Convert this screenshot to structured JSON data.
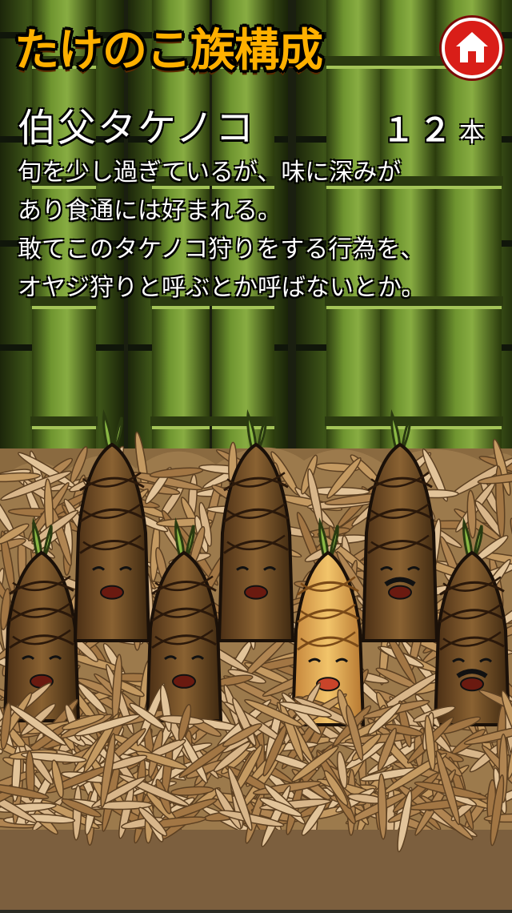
{
  "header": {
    "title": "たけのこ族構成",
    "home_button_icon": "home-icon"
  },
  "character": {
    "name": "伯父タケノコ",
    "count": "１２",
    "count_unit": "本",
    "description_lines": [
      "旬を少し過ぎているが、味に深みが",
      "あり食通には好まれる。",
      "敢てこのタケノコ狩りをする行為を、",
      "オヤジ狩りと呼ぶとか呼ばないとか。"
    ]
  },
  "family": [
    {
      "role": "baby",
      "highlighted": false
    },
    {
      "role": "winking-laughing",
      "highlighted": false
    },
    {
      "role": "angry-child",
      "highlighted": false
    },
    {
      "role": "smiling-mother",
      "highlighted": false
    },
    {
      "role": "uncle",
      "highlighted": true
    },
    {
      "role": "mustache-father",
      "highlighted": false
    },
    {
      "role": "old-grandpa",
      "highlighted": false
    }
  ],
  "colors": {
    "title": "#ffb000",
    "home_button": "#d91e18",
    "bamboo": "#6b8a2a",
    "soil": "#7a5a35",
    "shoot_dark": "#5a3a1c",
    "shoot_highlight": "#e4b060"
  }
}
